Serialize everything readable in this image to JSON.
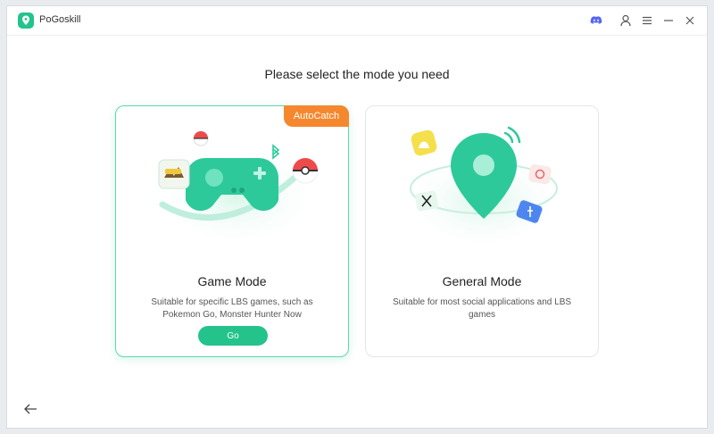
{
  "app": {
    "title": "PoGoskill"
  },
  "titlebar": {
    "icons": [
      "discord-icon",
      "user-icon",
      "menu-icon",
      "minimize-icon",
      "close-icon"
    ]
  },
  "main": {
    "heading": "Please select the mode you need"
  },
  "cards": {
    "game": {
      "badge": "AutoCatch",
      "title": "Game Mode",
      "description": "Suitable for specific LBS games, such as Pokemon Go, Monster Hunter Now",
      "button_label": "Go"
    },
    "general": {
      "title": "General Mode",
      "description": "Suitable for most social applications and LBS games"
    }
  },
  "colors": {
    "accent": "#24c38c",
    "badge": "#f5882e",
    "discord": "#5865f2"
  }
}
